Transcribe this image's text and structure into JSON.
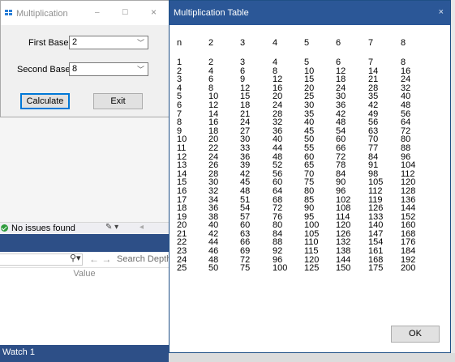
{
  "form": {
    "title": "Multiplication",
    "first_base_label": "First Base",
    "first_base_value": "2",
    "second_base_label": "Second Base",
    "second_base_value": "8",
    "calculate_label": "Calculate",
    "exit_label": "Exit",
    "minimize_glyph": "–",
    "maximize_glyph": "☐",
    "close_glyph": "×"
  },
  "dialog": {
    "title": "Multiplication Table",
    "close_glyph": "×",
    "ok_label": "OK",
    "columns": [
      "n",
      "2",
      "3",
      "4",
      "5",
      "6",
      "7",
      "8"
    ],
    "rows": [
      [
        "1",
        "2",
        "3",
        "4",
        "5",
        "6",
        "7",
        "8"
      ],
      [
        "2",
        "4",
        "6",
        "8",
        "10",
        "12",
        "14",
        "16"
      ],
      [
        "3",
        "6",
        "9",
        "12",
        "15",
        "18",
        "21",
        "24"
      ],
      [
        "4",
        "8",
        "12",
        "16",
        "20",
        "24",
        "28",
        "32"
      ],
      [
        "5",
        "10",
        "15",
        "20",
        "25",
        "30",
        "35",
        "40"
      ],
      [
        "6",
        "12",
        "18",
        "24",
        "30",
        "36",
        "42",
        "48"
      ],
      [
        "7",
        "14",
        "21",
        "28",
        "35",
        "42",
        "49",
        "56"
      ],
      [
        "8",
        "16",
        "24",
        "32",
        "40",
        "48",
        "56",
        "64"
      ],
      [
        "9",
        "18",
        "27",
        "36",
        "45",
        "54",
        "63",
        "72"
      ],
      [
        "10",
        "20",
        "30",
        "40",
        "50",
        "60",
        "70",
        "80"
      ],
      [
        "11",
        "22",
        "33",
        "44",
        "55",
        "66",
        "77",
        "88"
      ],
      [
        "12",
        "24",
        "36",
        "48",
        "60",
        "72",
        "84",
        "96"
      ],
      [
        "13",
        "26",
        "39",
        "52",
        "65",
        "78",
        "91",
        "104"
      ],
      [
        "14",
        "28",
        "42",
        "56",
        "70",
        "84",
        "98",
        "112"
      ],
      [
        "15",
        "30",
        "45",
        "60",
        "75",
        "90",
        "105",
        "120"
      ],
      [
        "16",
        "32",
        "48",
        "64",
        "80",
        "96",
        "112",
        "128"
      ],
      [
        "17",
        "34",
        "51",
        "68",
        "85",
        "102",
        "119",
        "136"
      ],
      [
        "18",
        "36",
        "54",
        "72",
        "90",
        "108",
        "126",
        "144"
      ],
      [
        "19",
        "38",
        "57",
        "76",
        "95",
        "114",
        "133",
        "152"
      ],
      [
        "20",
        "40",
        "60",
        "80",
        "100",
        "120",
        "140",
        "160"
      ],
      [
        "21",
        "42",
        "63",
        "84",
        "105",
        "126",
        "147",
        "168"
      ],
      [
        "22",
        "44",
        "66",
        "88",
        "110",
        "132",
        "154",
        "176"
      ],
      [
        "23",
        "46",
        "69",
        "92",
        "115",
        "138",
        "161",
        "184"
      ],
      [
        "24",
        "48",
        "72",
        "96",
        "120",
        "144",
        "168",
        "192"
      ],
      [
        "25",
        "50",
        "75",
        "100",
        "125",
        "150",
        "175",
        "200"
      ]
    ]
  },
  "ide": {
    "issues_text": "No issues found",
    "search_depth_label": "Search Depth:",
    "value_header": "Value",
    "watch_tab": "Watch 1"
  }
}
